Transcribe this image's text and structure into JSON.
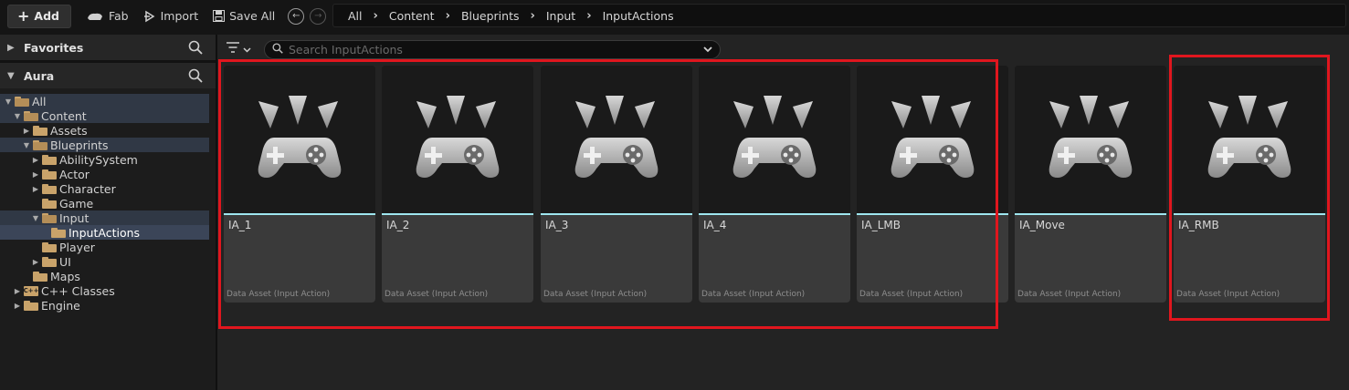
{
  "toolbar": {
    "add_label": "Add",
    "fab_label": "Fab",
    "import_label": "Import",
    "save_all_label": "Save All"
  },
  "breadcrumb": [
    "All",
    "Content",
    "Blueprints",
    "Input",
    "InputActions"
  ],
  "sidebar": {
    "favorites_label": "Favorites",
    "project_label": "Aura",
    "tree": [
      {
        "label": "All",
        "depth": 0,
        "expanded": true,
        "kind": "folder",
        "state": "highlight"
      },
      {
        "label": "Content",
        "depth": 1,
        "expanded": true,
        "kind": "folder",
        "state": "highlight"
      },
      {
        "label": "Assets",
        "depth": 2,
        "expanded": false,
        "kind": "folder",
        "state": ""
      },
      {
        "label": "Blueprints",
        "depth": 2,
        "expanded": true,
        "kind": "folder",
        "state": "highlight"
      },
      {
        "label": "AbilitySystem",
        "depth": 3,
        "expanded": false,
        "kind": "folder",
        "state": ""
      },
      {
        "label": "Actor",
        "depth": 3,
        "expanded": false,
        "kind": "folder",
        "state": ""
      },
      {
        "label": "Character",
        "depth": 3,
        "expanded": false,
        "kind": "folder",
        "state": ""
      },
      {
        "label": "Game",
        "depth": 3,
        "expanded": null,
        "kind": "folder",
        "state": ""
      },
      {
        "label": "Input",
        "depth": 3,
        "expanded": true,
        "kind": "folder",
        "state": "highlight"
      },
      {
        "label": "InputActions",
        "depth": 4,
        "expanded": null,
        "kind": "folder",
        "state": "selected"
      },
      {
        "label": "Player",
        "depth": 3,
        "expanded": null,
        "kind": "folder",
        "state": ""
      },
      {
        "label": "UI",
        "depth": 3,
        "expanded": false,
        "kind": "folder",
        "state": ""
      },
      {
        "label": "Maps",
        "depth": 2,
        "expanded": null,
        "kind": "folder",
        "state": ""
      },
      {
        "label": "C++ Classes",
        "depth": 1,
        "expanded": false,
        "kind": "cpp",
        "state": ""
      },
      {
        "label": "Engine",
        "depth": 1,
        "expanded": false,
        "kind": "folder",
        "state": ""
      }
    ]
  },
  "search": {
    "placeholder": "Search InputActions",
    "value": ""
  },
  "assets": [
    {
      "name": "IA_1",
      "type": "Data Asset (Input Action)"
    },
    {
      "name": "IA_2",
      "type": "Data Asset (Input Action)"
    },
    {
      "name": "IA_3",
      "type": "Data Asset (Input Action)"
    },
    {
      "name": "IA_4",
      "type": "Data Asset (Input Action)"
    },
    {
      "name": "IA_LMB",
      "type": "Data Asset (Input Action)"
    },
    {
      "name": "IA_Move",
      "type": "Data Asset (Input Action)"
    },
    {
      "name": "IA_RMB",
      "type": "Data Asset (Input Action)"
    }
  ],
  "colors": {
    "accent_underline": "#9ee6ef",
    "highlight_box": "#e0161e",
    "folder": "#c9a36a",
    "selected_row": "#3b4558"
  },
  "icons": {
    "asset_thumbnail": "gamepad-icon",
    "filter": "filter-icon",
    "search": "search-icon"
  }
}
